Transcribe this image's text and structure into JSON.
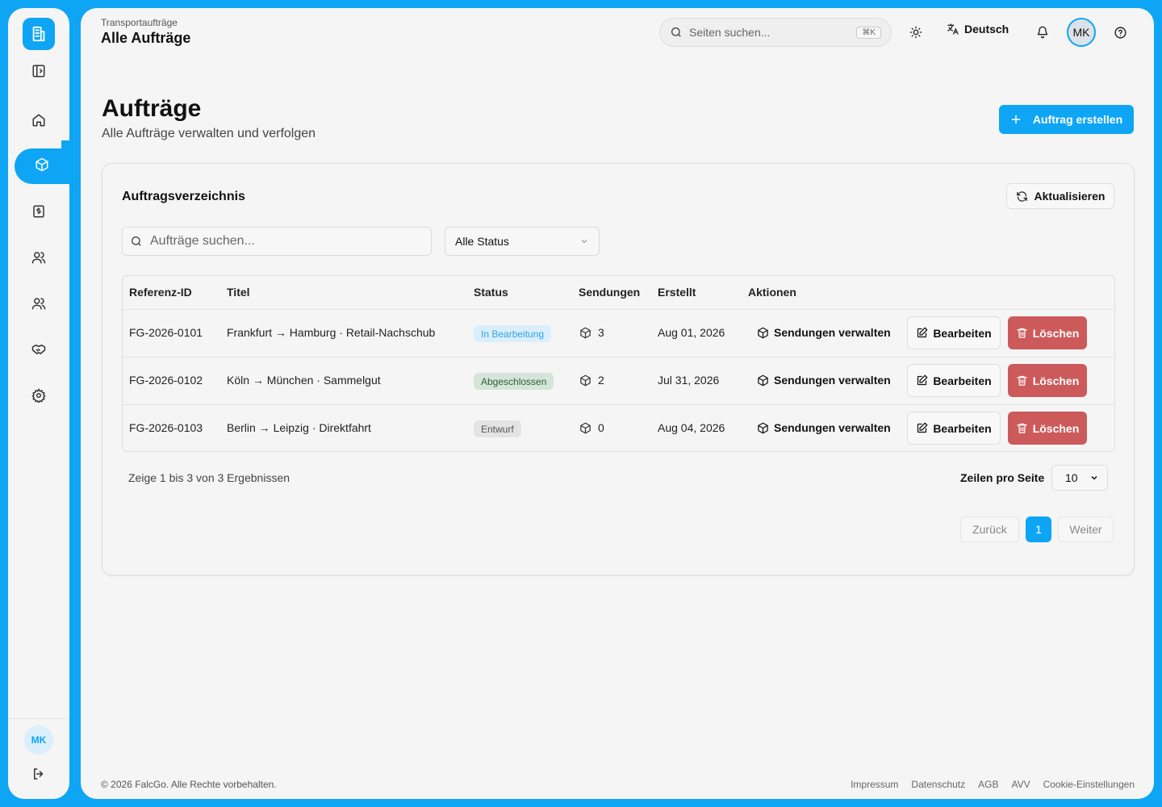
{
  "sidebar": {
    "icons": [
      "building-icon",
      "panel-toggle-icon",
      "home-icon",
      "package-icon",
      "invoice-icon",
      "users-icon",
      "users-icon",
      "handshake-icon",
      "settings-icon"
    ],
    "user_initials": "MK"
  },
  "topbar": {
    "breadcrumb": "Transportaufträge",
    "title": "Alle Aufträge",
    "search_placeholder": "Seiten suchen...",
    "search_shortcut": "⌘K",
    "language": "Deutsch",
    "user_initials": "MK"
  },
  "page": {
    "title": "Aufträge",
    "subtitle": "Alle Aufträge verwalten und verfolgen",
    "create_label": "Auftrag erstellen"
  },
  "card": {
    "title": "Auftragsverzeichnis",
    "refresh_label": "Aktualisieren",
    "search_placeholder": "Aufträge suchen...",
    "status_filter": "Alle Status"
  },
  "table": {
    "headers": {
      "ref": "Referenz-ID",
      "title": "Titel",
      "status": "Status",
      "shipments": "Sendungen",
      "created": "Erstellt",
      "actions": "Aktionen"
    },
    "rows": [
      {
        "ref": "FG-2026-0101",
        "title": "Frankfurt → Hamburg · Retail-Nachschub",
        "status": "In Bearbeitung",
        "shipments": "3",
        "created": "Aug 01, 2026"
      },
      {
        "ref": "FG-2026-0102",
        "title": "Köln → München · Sammelgut",
        "status": "Abgeschlossen",
        "shipments": "2",
        "created": "Jul 31, 2026"
      },
      {
        "ref": "FG-2026-0103",
        "title": "Berlin → Leipzig · Direktfahrt",
        "status": "Entwurf",
        "shipments": "0",
        "created": "Aug 04, 2026"
      }
    ],
    "manage_label": "Sendungen verwalten",
    "edit_label": "Bearbeiten",
    "delete_label": "Löschen"
  },
  "pagination": {
    "results_text": "Zeige 1 bis 3 von 3 Ergebnissen",
    "rows_per_page_label": "Zeilen pro Seite",
    "rows_per_page": "10",
    "prev_label": "Zurück",
    "current_page": "1",
    "next_label": "Weiter"
  },
  "footer": {
    "copyright": "© 2026 FalcGo. Alle Rechte vorbehalten.",
    "links": [
      "Impressum",
      "Datenschutz",
      "AGB",
      "AVV",
      "Cookie-Einstellungen"
    ]
  },
  "colors": {
    "accent": "#0ea5f5",
    "danger": "#cd5a5a",
    "status_in_progress": "#2fa3ea",
    "status_done": "#2d5e3b",
    "status_draft": "#555555"
  }
}
